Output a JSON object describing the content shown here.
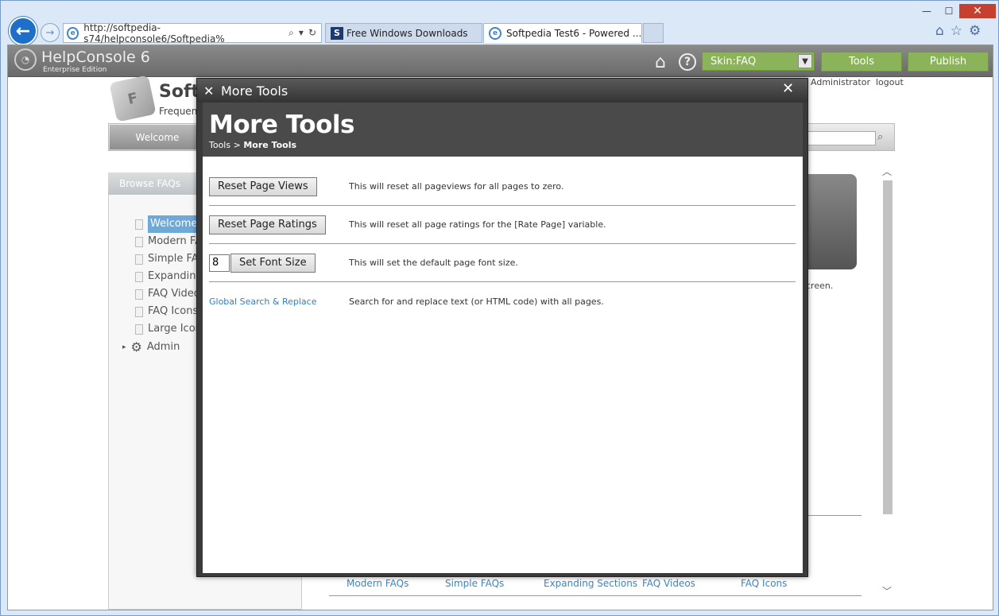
{
  "browser": {
    "address": "http://softpedia-s74/helpconsole6/Softpedia%",
    "tabs": [
      {
        "label": "Free Windows Downloads"
      },
      {
        "label": "Softpedia Test6 - Powered ..."
      }
    ],
    "window_controls": {
      "minimize": "—",
      "maximize": "☐",
      "close": "✕"
    }
  },
  "helpconsole": {
    "title": "HelpConsole 6",
    "edition": "Enterprise Edition",
    "skin_label": "Skin:FAQ",
    "tools_label": "Tools",
    "publish_label": "Publish",
    "user": "Administrator",
    "logout": "logout"
  },
  "site": {
    "title": "Soft",
    "subtitle": "Frequen",
    "nav_welcome": "Welcome",
    "browse_label": "Browse FAQs",
    "tree": [
      "Welcome",
      "Modern FA",
      "Simple FA",
      "Expanding",
      "FAQ Video",
      "FAQ Icons",
      "Large Icon"
    ],
    "admin": "Admin",
    "right_text": "creen.",
    "bottom_links": [
      "Modern FAQs",
      "Simple FAQs",
      "Expanding Sections",
      "FAQ Videos",
      "FAQ Icons"
    ]
  },
  "modal": {
    "header": "More Tools",
    "banner_title": "More Tools",
    "crumb_parent": "Tools",
    "crumb_sep": ">",
    "crumb_current": "More Tools",
    "rows": [
      {
        "button": "Reset Page Views",
        "desc": "This will reset all pageviews for all pages to zero."
      },
      {
        "button": "Reset Page Ratings",
        "desc": "This will reset all page ratings for the [Rate Page] variable."
      },
      {
        "input": "8",
        "button": "Set Font Size",
        "desc": "This will set the default page font size."
      },
      {
        "link": "Global Search & Replace",
        "desc": "Search for and replace text (or HTML code) with all pages."
      }
    ]
  },
  "colors": {
    "accent_green": "#8bb35a",
    "link_blue": "#2f7fc0",
    "modal_dark": "#3a3a3a"
  }
}
